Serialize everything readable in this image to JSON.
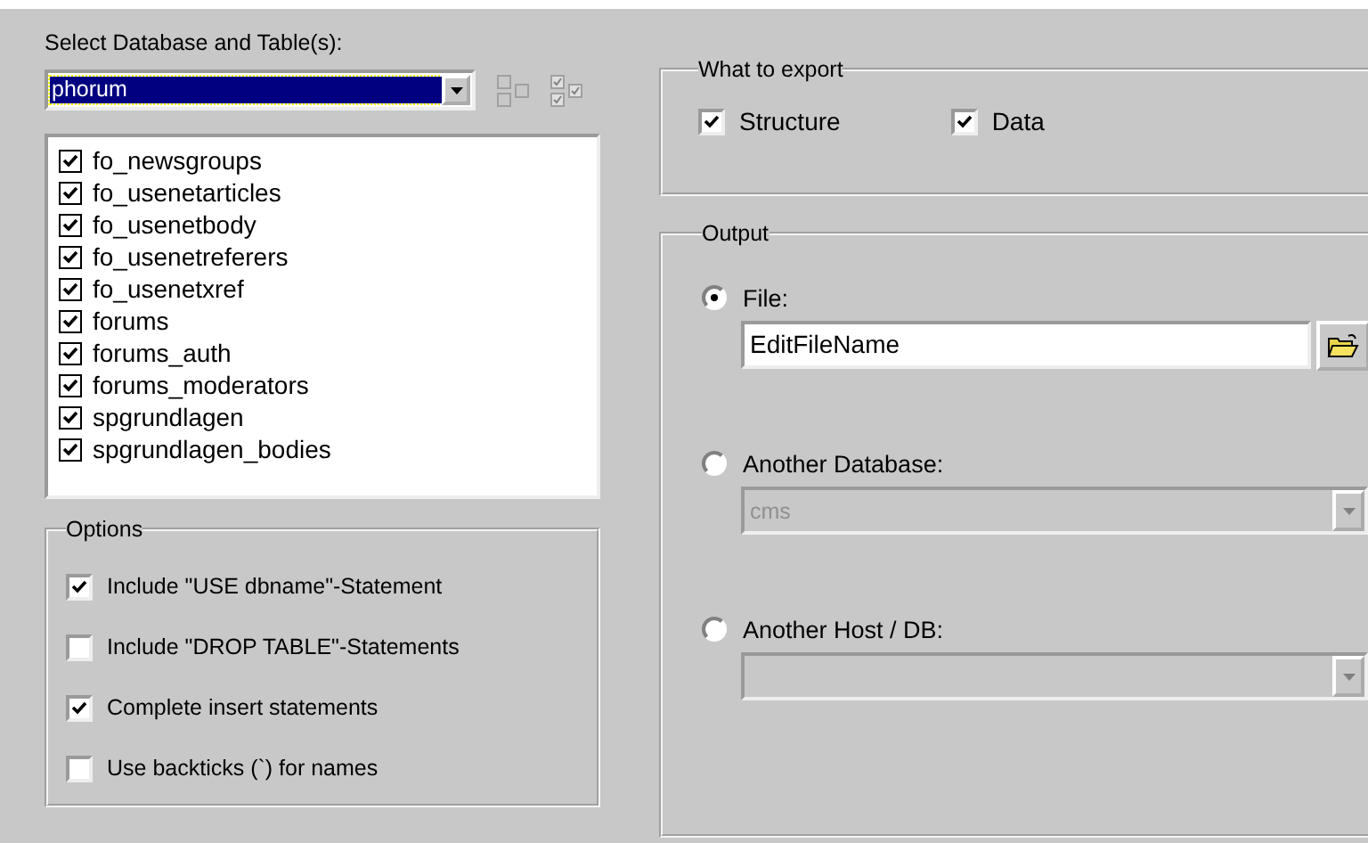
{
  "database_label": "Select Database and Table(s):",
  "database_select": {
    "value": "phorum"
  },
  "tables": [
    {
      "name": "fo_newsgroups",
      "checked": true
    },
    {
      "name": "fo_usenetarticles",
      "checked": true
    },
    {
      "name": "fo_usenetbody",
      "checked": true
    },
    {
      "name": "fo_usenetreferers",
      "checked": true
    },
    {
      "name": "fo_usenetxref",
      "checked": true
    },
    {
      "name": "forums",
      "checked": true
    },
    {
      "name": "forums_auth",
      "checked": true
    },
    {
      "name": "forums_moderators",
      "checked": true
    },
    {
      "name": "spgrundlagen",
      "checked": true
    },
    {
      "name": "spgrundlagen_bodies",
      "checked": true
    }
  ],
  "options": {
    "title": "Options",
    "items": [
      {
        "label": "Include \"USE dbname\"-Statement",
        "checked": true
      },
      {
        "label": "Include \"DROP TABLE\"-Statements",
        "checked": false
      },
      {
        "label": "Complete insert statements",
        "checked": true
      },
      {
        "label": "Use backticks (`) for names",
        "checked": false
      }
    ]
  },
  "export": {
    "title": "What to export",
    "items": [
      {
        "label": "Structure",
        "checked": true
      },
      {
        "label": "Data",
        "checked": true
      }
    ]
  },
  "output": {
    "title": "Output",
    "targets": [
      {
        "label": "File:",
        "selected": true,
        "kind": "file",
        "value": "EditFileName",
        "disabled": false
      },
      {
        "label": "Another Database:",
        "selected": false,
        "kind": "combo",
        "value": "cms",
        "disabled": true
      },
      {
        "label": "Another Host / DB:",
        "selected": false,
        "kind": "combo",
        "disabled": true
      }
    ]
  }
}
